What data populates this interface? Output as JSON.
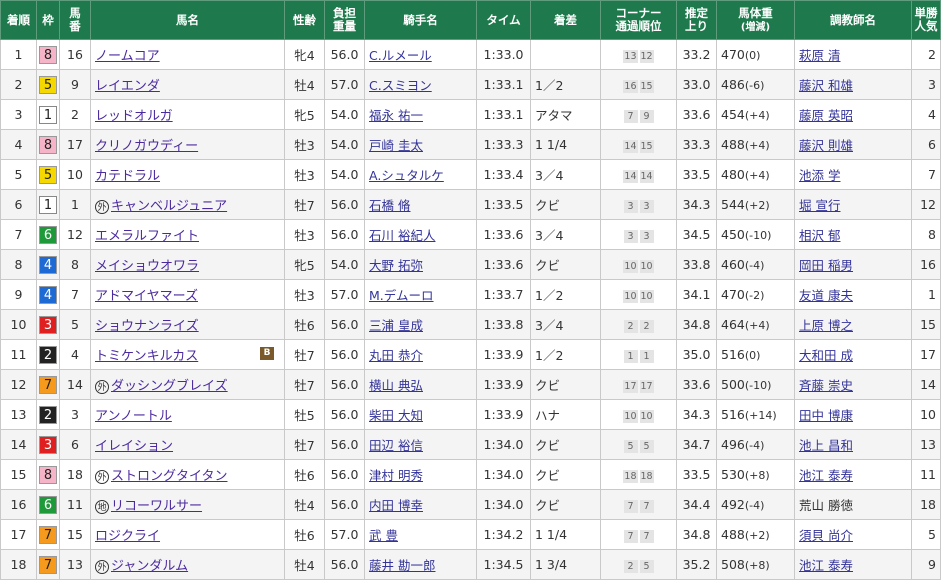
{
  "headers": {
    "rank": "着順",
    "waku": "枠",
    "umaban_1": "馬",
    "umaban_2": "番",
    "horse": "馬名",
    "sexage": "性齢",
    "weight_1": "負担",
    "weight_2": "重量",
    "jockey": "騎手名",
    "time": "タイム",
    "margin": "着差",
    "corner_1": "コーナー",
    "corner_2": "通過順位",
    "agari_1": "推定",
    "agari_2": "上り",
    "bw_1": "馬体重",
    "bw_2": "(増減)",
    "trainer": "調教師名",
    "pop_1": "単勝",
    "pop_2": "人気"
  },
  "colors": {
    "header_bg": "#1e7a4c",
    "waku": {
      "1": "#ffffff",
      "2": "#222222",
      "3": "#e02020",
      "4": "#1e6ad4",
      "5": "#f5d800",
      "6": "#1f9a3a",
      "7": "#f59a1c",
      "8": "#f6b4c8"
    }
  },
  "rows": [
    {
      "rank": "1",
      "waku": "8",
      "num": "16",
      "badge": "",
      "horse": "ノームコア",
      "blinker": "",
      "sex": "牝4",
      "wt": "56.0",
      "jockey": "C.ルメール",
      "time": "1:33.0",
      "margin": "",
      "c1": "13",
      "c2": "12",
      "agari": "33.2",
      "bw": "470",
      "bwc": "(0)",
      "trainer": "萩原 清",
      "trainer_link": true,
      "pop": "2"
    },
    {
      "rank": "2",
      "waku": "5",
      "num": "9",
      "badge": "",
      "horse": "レイエンダ",
      "blinker": "",
      "sex": "牡4",
      "wt": "57.0",
      "jockey": "C.スミヨン",
      "time": "1:33.1",
      "margin": "1／2",
      "c1": "16",
      "c2": "15",
      "agari": "33.0",
      "bw": "486",
      "bwc": "(-6)",
      "trainer": "藤沢 和雄",
      "trainer_link": true,
      "pop": "3"
    },
    {
      "rank": "3",
      "waku": "1",
      "num": "2",
      "badge": "",
      "horse": "レッドオルガ",
      "blinker": "",
      "sex": "牝5",
      "wt": "54.0",
      "jockey": "福永 祐一",
      "time": "1:33.1",
      "margin": "アタマ",
      "c1": "7",
      "c2": "9",
      "agari": "33.6",
      "bw": "454",
      "bwc": "(+4)",
      "trainer": "藤原 英昭",
      "trainer_link": true,
      "pop": "4"
    },
    {
      "rank": "4",
      "waku": "8",
      "num": "17",
      "badge": "",
      "horse": "クリノガウディー",
      "blinker": "",
      "sex": "牡3",
      "wt": "54.0",
      "jockey": "戸崎 圭太",
      "time": "1:33.3",
      "margin": "1 1/4",
      "c1": "14",
      "c2": "15",
      "agari": "33.3",
      "bw": "488",
      "bwc": "(+4)",
      "trainer": "藤沢 則雄",
      "trainer_link": true,
      "pop": "6"
    },
    {
      "rank": "5",
      "waku": "5",
      "num": "10",
      "badge": "",
      "horse": "カテドラル",
      "blinker": "",
      "sex": "牡3",
      "wt": "54.0",
      "jockey": "A.シュタルケ",
      "time": "1:33.4",
      "margin": "3／4",
      "c1": "14",
      "c2": "14",
      "agari": "33.5",
      "bw": "480",
      "bwc": "(+4)",
      "trainer": "池添 学",
      "trainer_link": true,
      "pop": "7"
    },
    {
      "rank": "6",
      "waku": "1",
      "num": "1",
      "badge": "外",
      "horse": "キャンベルジュニア",
      "blinker": "",
      "sex": "牡7",
      "wt": "56.0",
      "jockey": "石橋 脩",
      "time": "1:33.5",
      "margin": "クビ",
      "c1": "3",
      "c2": "3",
      "agari": "34.3",
      "bw": "544",
      "bwc": "(+2)",
      "trainer": "堀 宣行",
      "trainer_link": true,
      "pop": "12"
    },
    {
      "rank": "7",
      "waku": "6",
      "num": "12",
      "badge": "",
      "horse": "エメラルファイト",
      "blinker": "",
      "sex": "牡3",
      "wt": "56.0",
      "jockey": "石川 裕紀人",
      "time": "1:33.6",
      "margin": "3／4",
      "c1": "3",
      "c2": "3",
      "agari": "34.5",
      "bw": "450",
      "bwc": "(-10)",
      "trainer": "相沢 郁",
      "trainer_link": true,
      "pop": "8"
    },
    {
      "rank": "8",
      "waku": "4",
      "num": "8",
      "badge": "",
      "horse": "メイショウオワラ",
      "blinker": "",
      "sex": "牝5",
      "wt": "54.0",
      "jockey": "大野 拓弥",
      "time": "1:33.6",
      "margin": "クビ",
      "c1": "10",
      "c2": "10",
      "agari": "33.8",
      "bw": "460",
      "bwc": "(-4)",
      "trainer": "岡田 稲男",
      "trainer_link": true,
      "pop": "16"
    },
    {
      "rank": "9",
      "waku": "4",
      "num": "7",
      "badge": "",
      "horse": "アドマイヤマーズ",
      "blinker": "",
      "sex": "牡3",
      "wt": "57.0",
      "jockey": "M.デムーロ",
      "time": "1:33.7",
      "margin": "1／2",
      "c1": "10",
      "c2": "10",
      "agari": "34.1",
      "bw": "470",
      "bwc": "(-2)",
      "trainer": "友道 康夫",
      "trainer_link": true,
      "pop": "1"
    },
    {
      "rank": "10",
      "waku": "3",
      "num": "5",
      "badge": "",
      "horse": "ショウナンライズ",
      "blinker": "",
      "sex": "牡6",
      "wt": "56.0",
      "jockey": "三浦 皇成",
      "time": "1:33.8",
      "margin": "3／4",
      "c1": "2",
      "c2": "2",
      "agari": "34.8",
      "bw": "464",
      "bwc": "(+4)",
      "trainer": "上原 博之",
      "trainer_link": true,
      "pop": "15"
    },
    {
      "rank": "11",
      "waku": "2",
      "num": "4",
      "badge": "",
      "horse": "トミケンキルカス",
      "blinker": "B",
      "sex": "牡7",
      "wt": "56.0",
      "jockey": "丸田 恭介",
      "time": "1:33.9",
      "margin": "1／2",
      "c1": "1",
      "c2": "1",
      "agari": "35.0",
      "bw": "516",
      "bwc": "(0)",
      "trainer": "大和田 成",
      "trainer_link": true,
      "pop": "17"
    },
    {
      "rank": "12",
      "waku": "7",
      "num": "14",
      "badge": "外",
      "horse": "ダッシングブレイズ",
      "blinker": "",
      "sex": "牡7",
      "wt": "56.0",
      "jockey": "横山 典弘",
      "time": "1:33.9",
      "margin": "クビ",
      "c1": "17",
      "c2": "17",
      "agari": "33.6",
      "bw": "500",
      "bwc": "(-10)",
      "trainer": "斉藤 崇史",
      "trainer_link": true,
      "pop": "14"
    },
    {
      "rank": "13",
      "waku": "2",
      "num": "3",
      "badge": "",
      "horse": "アンノートル",
      "blinker": "",
      "sex": "牡5",
      "wt": "56.0",
      "jockey": "柴田 大知",
      "time": "1:33.9",
      "margin": "ハナ",
      "c1": "10",
      "c2": "10",
      "agari": "34.3",
      "bw": "516",
      "bwc": "(+14)",
      "trainer": "田中 博康",
      "trainer_link": true,
      "pop": "10"
    },
    {
      "rank": "14",
      "waku": "3",
      "num": "6",
      "badge": "",
      "horse": "イレイション",
      "blinker": "",
      "sex": "牡7",
      "wt": "56.0",
      "jockey": "田辺 裕信",
      "time": "1:34.0",
      "margin": "クビ",
      "c1": "5",
      "c2": "5",
      "agari": "34.7",
      "bw": "496",
      "bwc": "(-4)",
      "trainer": "池上 昌和",
      "trainer_link": true,
      "pop": "13"
    },
    {
      "rank": "15",
      "waku": "8",
      "num": "18",
      "badge": "外",
      "horse": "ストロングタイタン",
      "blinker": "",
      "sex": "牡6",
      "wt": "56.0",
      "jockey": "津村 明秀",
      "time": "1:34.0",
      "margin": "クビ",
      "c1": "18",
      "c2": "18",
      "agari": "33.5",
      "bw": "530",
      "bwc": "(+8)",
      "trainer": "池江 泰寿",
      "trainer_link": true,
      "pop": "11"
    },
    {
      "rank": "16",
      "waku": "6",
      "num": "11",
      "badge": "地",
      "horse": "リコーワルサー",
      "blinker": "",
      "sex": "牡4",
      "wt": "56.0",
      "jockey": "内田 博幸",
      "time": "1:34.0",
      "margin": "クビ",
      "c1": "7",
      "c2": "7",
      "agari": "34.4",
      "bw": "492",
      "bwc": "(-4)",
      "trainer": "荒山 勝徳",
      "trainer_link": false,
      "pop": "18"
    },
    {
      "rank": "17",
      "waku": "7",
      "num": "15",
      "badge": "",
      "horse": "ロジクライ",
      "blinker": "",
      "sex": "牡6",
      "wt": "57.0",
      "jockey": "武 豊",
      "time": "1:34.2",
      "margin": "1 1/4",
      "c1": "7",
      "c2": "7",
      "agari": "34.8",
      "bw": "488",
      "bwc": "(+2)",
      "trainer": "須貝 尚介",
      "trainer_link": true,
      "pop": "5"
    },
    {
      "rank": "18",
      "waku": "7",
      "num": "13",
      "badge": "外",
      "horse": "ジャンダルム",
      "blinker": "",
      "sex": "牡4",
      "wt": "56.0",
      "jockey": "藤井 勘一郎",
      "time": "1:34.5",
      "margin": "1 3/4",
      "c1": "2",
      "c2": "5",
      "agari": "35.2",
      "bw": "508",
      "bwc": "(+8)",
      "trainer": "池江 泰寿",
      "trainer_link": true,
      "pop": "9"
    }
  ]
}
